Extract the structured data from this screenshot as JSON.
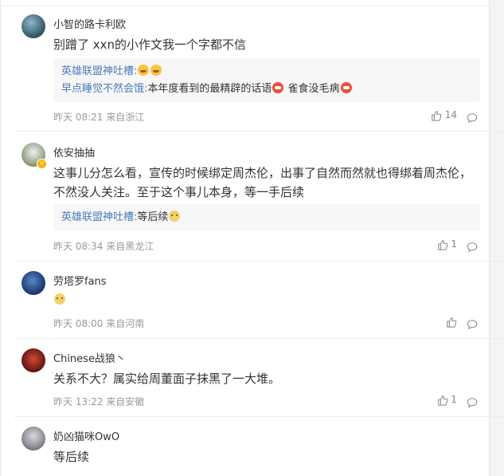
{
  "colors": {
    "link": "#4a7db6",
    "meta": "#999999",
    "reply_bg": "#f7f7f7"
  },
  "comments": [
    {
      "username": "小智的路卡利欧",
      "text": "别蹭了 xxn的小作文我一个字都不信",
      "replies": [
        {
          "user": "英雄联盟神吐槽:",
          "text": "",
          "emojis": [
            "laugh-tears-emoji",
            "laugh-tears-emoji"
          ]
        },
        {
          "user": "早点睡觉不然会饿:",
          "text": "本年度看到的最精辟的话语",
          "emojis": [
            "red-face-emoji"
          ],
          "text2": " 雀食没毛病",
          "emojis2": [
            "red-face-emoji"
          ]
        }
      ],
      "time": "昨天 08:21",
      "location": "来自浙江",
      "likes": "14"
    },
    {
      "username": "依安抽抽",
      "text": "这事儿分怎么看，宣传的时候绑定周杰伦，出事了自然而然就也得绑着周杰伦，不然没人关注。至于这个事儿本身，等一手后续",
      "replies": [
        {
          "user": "英雄联盟神吐槽:",
          "text": "等后续",
          "emojis": [
            "happy-face-emoji"
          ]
        }
      ],
      "time": "昨天 08:34",
      "location": "来自黑龙江",
      "likes": "1"
    },
    {
      "username": "劳塔罗fans",
      "text": "",
      "time": "昨天 08:00",
      "location": "来自河南",
      "likes": ""
    },
    {
      "username": "Chinese战狼丶",
      "text": "关系不大？属实给周董面子抹黑了一大堆。",
      "time": "昨天 13:22",
      "location": "来自安徽",
      "likes": "1"
    },
    {
      "username": "奶凶猫咪OwO",
      "text": "等后续",
      "time": "",
      "location": "",
      "likes": ""
    }
  ]
}
